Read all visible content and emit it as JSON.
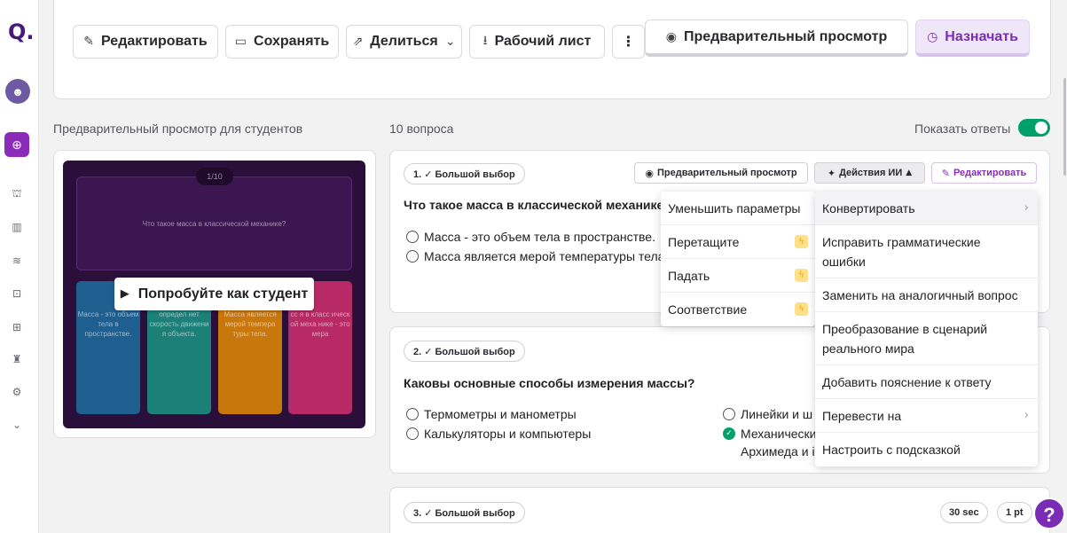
{
  "rail": {
    "logo": "Q.",
    "icons": [
      "create-icon",
      "library-icon",
      "reports-icon",
      "classes-icon",
      "media-icon",
      "school-icon",
      "settings-icon",
      "expand-icon"
    ]
  },
  "toolbar": {
    "edit": "Редактировать",
    "save": "Сохранять",
    "share": "Делиться",
    "worksheet": "Рабочий лист",
    "more": "⋮",
    "preview": "Предварительный просмотр",
    "assign": "Назначать"
  },
  "student_preview": {
    "title": "Предварительный просмотр для студентов",
    "counter": "1/10",
    "question": "Что такое масса в классической механике?",
    "options": [
      "Масса - это объем тела в пространстве.",
      "определ нет скорость движени я объекта.",
      "Масса является мерой темпера туры тела.",
      "сс я в класс ическ ой меха нике - это мера"
    ],
    "try_button": "Попробуйте как студент"
  },
  "questions_header": {
    "count": "10 вопроса",
    "show_answers": "Показать ответы"
  },
  "q1": {
    "type": "1. ✓ Большой выбор",
    "preview_btn": "Предварительный просмотр",
    "ai_btn": "Действия ИИ",
    "edit_btn": "Редактировать",
    "text": "Что такое масса в классической механике?",
    "answers": [
      "Масса - это объем тела в пространстве.",
      "Масса является мерой температуры тела."
    ]
  },
  "q2": {
    "type": "2. ✓ Большой выбор",
    "text": "Каковы основные способы измерения массы?",
    "answers": [
      "Термометры и манометры",
      "Калькуляторы и компьютеры",
      "Линейки и ш",
      "Механически",
      "Архимеда и і"
    ]
  },
  "q3": {
    "type": "3. ✓ Большой выбор",
    "time": "30 sec",
    "points": "1 pt"
  },
  "submenu": {
    "items": [
      "Уменьшить параметры",
      "Перетащите",
      "Падать",
      "Соответствие"
    ]
  },
  "ai_menu": {
    "items": [
      "Конвертировать",
      "Исправить грамматические ошибки",
      "Заменить на аналогичный вопрос",
      "Преобразование в сценарий реального мира",
      "Добавить пояснение к ответу",
      "Перевести на",
      "Настроить с подсказкой"
    ]
  },
  "help": "?"
}
